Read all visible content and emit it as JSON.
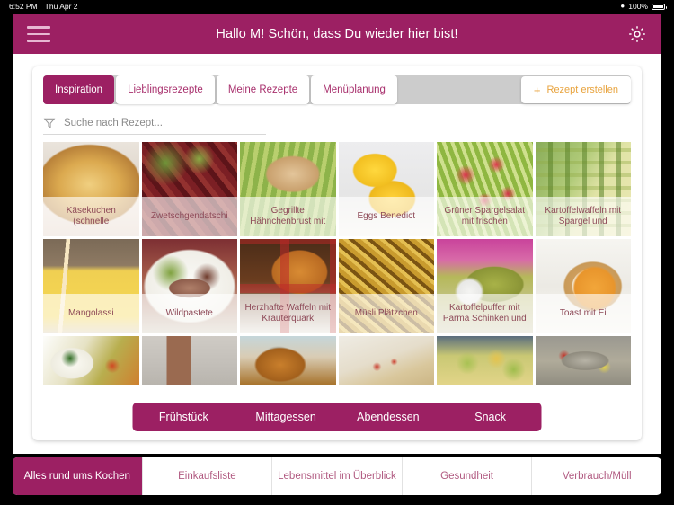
{
  "status_bar": {
    "time": "6:52 PM",
    "date": "Thu Apr 2",
    "wifi_icon": "wifi-icon",
    "battery_percent": "100%"
  },
  "header": {
    "menu_icon": "hamburger-menu-icon",
    "title": "Hallo M! Schön, dass Du wieder hier bist!",
    "settings_icon": "gear-icon",
    "background_color": "#9c2063"
  },
  "tabs": [
    {
      "label": "Inspiration",
      "active": true
    },
    {
      "label": "Lieblingsrezepte",
      "active": false
    },
    {
      "label": "Meine Rezepte",
      "active": false
    },
    {
      "label": "Menüplanung",
      "active": false
    }
  ],
  "create_button": {
    "plus": "+",
    "label": "Rezept erstellen",
    "color": "#e8a33d"
  },
  "search": {
    "filter_icon": "funnel-filter-icon",
    "placeholder": "Suche nach Rezept...",
    "value": ""
  },
  "recipes": {
    "row1": [
      {
        "title": "Käsekuchen (schnelle",
        "image": "cheesecake-photo"
      },
      {
        "title": "Zwetschgendatschi",
        "image": "plum-cake-photo"
      },
      {
        "title": "Gegrillte Hähnchenbrust mit",
        "image": "grilled-chicken-photo"
      },
      {
        "title": "Eggs Benedict",
        "image": "eggs-benedict-photo"
      },
      {
        "title": "Grüner Spargelsalat mit frischen",
        "image": "asparagus-salad-photo"
      },
      {
        "title": "Kartoffelwaffeln mit Spargel und",
        "image": "potato-waffles-photo"
      }
    ],
    "row2": [
      {
        "title": "Mangolassi",
        "image": "mango-lassi-photo"
      },
      {
        "title": "Wildpastete",
        "image": "game-pate-photo"
      },
      {
        "title": "Herzhafte Waffeln mit Kräuterquark",
        "image": "savory-waffles-photo"
      },
      {
        "title": "Müsli Plätzchen",
        "image": "muesli-cookies-photo"
      },
      {
        "title": "Kartoffelpuffer mit Parma Schinken und",
        "image": "potato-pancakes-photo"
      },
      {
        "title": "Toast mit Ei",
        "image": "toast-with-egg-photo"
      }
    ],
    "row3": [
      {
        "title": "",
        "image": "rice-vegetables-photo"
      },
      {
        "title": "",
        "image": "chocolate-drink-bottle-photo"
      },
      {
        "title": "",
        "image": "roast-chicken-photo"
      },
      {
        "title": "",
        "image": "stuffed-pastry-photo"
      },
      {
        "title": "",
        "image": "vegetable-stew-photo"
      },
      {
        "title": "",
        "image": "baked-fish-photo"
      }
    ]
  },
  "meal_bar": {
    "items": [
      "Frühstück",
      "Mittagessen",
      "Abendessen",
      "Snack"
    ],
    "background_color": "#9c2063"
  },
  "bottom_nav": [
    {
      "label": "Alles rund ums Kochen",
      "active": true
    },
    {
      "label": "Einkaufsliste",
      "active": false
    },
    {
      "label": "Lebensmittel im Überblick",
      "active": false
    },
    {
      "label": "Gesundheit",
      "active": false
    },
    {
      "label": "Verbrauch/Müll",
      "active": false
    }
  ]
}
